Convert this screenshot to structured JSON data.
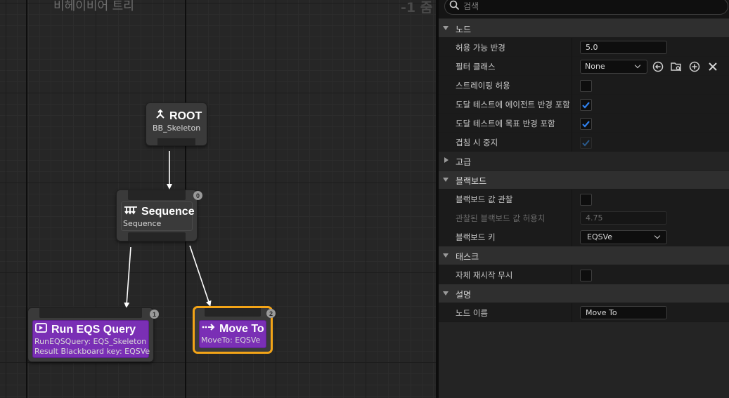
{
  "graph": {
    "title": "비헤이비어 트리",
    "zoom": "-1 줌",
    "nodes": {
      "root": {
        "title": "ROOT",
        "subtitle": "BB_Skeleton"
      },
      "sequence": {
        "title": "Sequence",
        "subtitle": "Sequence",
        "index": "0"
      },
      "run_eqs": {
        "title": "Run EQS Query",
        "subtitle1": "RunEQSQuery: EQS_Skeleton",
        "subtitle2": "Result Blackboard key: EQSVe",
        "index": "1"
      },
      "move_to": {
        "title": "Move To",
        "subtitle": "MoveTo: EQSVe",
        "index": "2"
      }
    }
  },
  "details": {
    "search": {
      "placeholder": "검색",
      "value": ""
    },
    "sections": {
      "node": {
        "label": "노드",
        "acceptable_radius": {
          "label": "허용 가능 반경",
          "value": "5.0"
        },
        "filter_class": {
          "label": "필터 클래스",
          "value": "None"
        },
        "allow_strafe": {
          "label": "스트레이핑 허용",
          "checked": false
        },
        "reach_include_agent_radius": {
          "label": "도달 테스트에 에이전트 반경 포함",
          "checked": true
        },
        "reach_include_goal_radius": {
          "label": "도달 테스트에 목표 반경 포함",
          "checked": true
        },
        "stop_on_overlap": {
          "label": "겹침 시 중지",
          "checked": true,
          "disabled": true
        }
      },
      "advanced": {
        "label": "고급"
      },
      "blackboard": {
        "label": "블랙보드",
        "observe_value": {
          "label": "블랙보드 값 관찰",
          "checked": false
        },
        "observed_tolerance": {
          "label": "관찰된 블랙보드 값 허용치",
          "value": "4.75"
        },
        "blackboard_key": {
          "label": "블랙보드 키",
          "value": "EQSVe"
        }
      },
      "task": {
        "label": "태스크",
        "ignore_restart_self": {
          "label": "자체 재시작 무시",
          "checked": false
        }
      },
      "description": {
        "label": "설명",
        "node_name": {
          "label": "노드 이름",
          "value": "Move To"
        }
      }
    }
  },
  "colors": {
    "task_purple": "#7a2fb5",
    "selection_orange": "#f3a417",
    "checkbox_blue": "#2f80ed"
  }
}
